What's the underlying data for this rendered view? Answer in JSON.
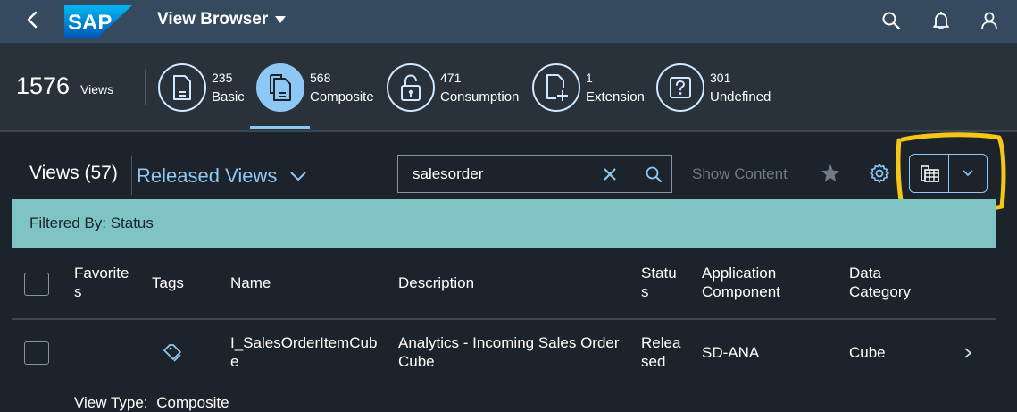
{
  "shell": {
    "logo_text": "SAP",
    "app_title": "View Browser",
    "icons": [
      "back-icon",
      "search-icon",
      "bell-icon",
      "user-icon"
    ]
  },
  "summary": {
    "total_count": "1576",
    "total_label": "Views",
    "categories": [
      {
        "count": "235",
        "label": "Basic",
        "icon": "document-icon"
      },
      {
        "count": "568",
        "label": "Composite",
        "icon": "documents-icon",
        "active": true
      },
      {
        "count": "471",
        "label": "Consumption",
        "icon": "unlocked-icon"
      },
      {
        "count": "1",
        "label": "Extension",
        "icon": "add-document-icon"
      },
      {
        "count": "301",
        "label": "Undefined",
        "icon": "question-icon"
      }
    ]
  },
  "toolbar": {
    "views_title": "Views (57)",
    "variant": "Released Views",
    "search_value": "salesorder",
    "show_content": "Show Content"
  },
  "filter": {
    "text": "Filtered By: Status"
  },
  "table": {
    "columns": {
      "favorites": [
        "Favorite",
        "s"
      ],
      "tags": "Tags",
      "name": "Name",
      "description": "Description",
      "status": [
        "Statu",
        "s"
      ],
      "app_component": [
        "Application",
        "Component"
      ],
      "data_category": [
        "Data",
        "Category"
      ]
    },
    "rows": [
      {
        "name": [
          "I_SalesOrderItemCub",
          "e"
        ],
        "description": [
          "Analytics - Incoming Sales Order",
          "Cube"
        ],
        "status": [
          "Relea",
          "sed"
        ],
        "app_component": "SD-ANA",
        "data_category": "Cube",
        "view_type_label": "View Type:",
        "view_type_value": "Composite"
      }
    ]
  },
  "colors": {
    "shell": "#354a5f",
    "header": "#29313a",
    "background": "#1d232a",
    "accent": "#8fc7f4",
    "filter_bar": "#7ec4c4",
    "highlight": "#f5c518"
  }
}
